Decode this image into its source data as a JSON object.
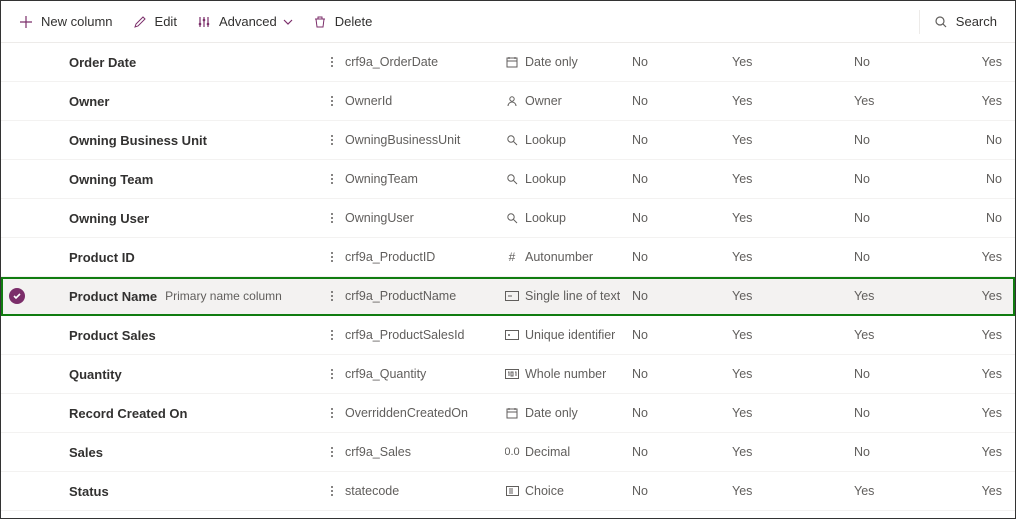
{
  "toolbar": {
    "new_column": "New column",
    "edit": "Edit",
    "advanced": "Advanced",
    "delete": "Delete",
    "search": "Search"
  },
  "type_icons": {
    "date": "calendar",
    "owner": "person",
    "lookup": "search",
    "autonumber": "hash",
    "text": "textfield",
    "unique": "id",
    "whole": "num",
    "decimal": "decimal",
    "choice": "choice"
  },
  "rows": [
    {
      "display": "Order Date",
      "badge": "",
      "name": "crf9a_OrderDate",
      "type_icon": "date",
      "type": "Date only",
      "c1": "No",
      "c2": "Yes",
      "c3": "No",
      "c4": "Yes",
      "selected": false
    },
    {
      "display": "Owner",
      "badge": "",
      "name": "OwnerId",
      "type_icon": "owner",
      "type": "Owner",
      "c1": "No",
      "c2": "Yes",
      "c3": "Yes",
      "c4": "Yes",
      "selected": false
    },
    {
      "display": "Owning Business Unit",
      "badge": "",
      "name": "OwningBusinessUnit",
      "type_icon": "lookup",
      "type": "Lookup",
      "c1": "No",
      "c2": "Yes",
      "c3": "No",
      "c4": "No",
      "selected": false
    },
    {
      "display": "Owning Team",
      "badge": "",
      "name": "OwningTeam",
      "type_icon": "lookup",
      "type": "Lookup",
      "c1": "No",
      "c2": "Yes",
      "c3": "No",
      "c4": "No",
      "selected": false
    },
    {
      "display": "Owning User",
      "badge": "",
      "name": "OwningUser",
      "type_icon": "lookup",
      "type": "Lookup",
      "c1": "No",
      "c2": "Yes",
      "c3": "No",
      "c4": "No",
      "selected": false
    },
    {
      "display": "Product ID",
      "badge": "",
      "name": "crf9a_ProductID",
      "type_icon": "autonumber",
      "type": "Autonumber",
      "c1": "No",
      "c2": "Yes",
      "c3": "No",
      "c4": "Yes",
      "selected": false
    },
    {
      "display": "Product Name",
      "badge": "Primary name column",
      "name": "crf9a_ProductName",
      "type_icon": "text",
      "type": "Single line of text",
      "c1": "No",
      "c2": "Yes",
      "c3": "Yes",
      "c4": "Yes",
      "selected": true
    },
    {
      "display": "Product Sales",
      "badge": "",
      "name": "crf9a_ProductSalesId",
      "type_icon": "unique",
      "type": "Unique identifier",
      "c1": "No",
      "c2": "Yes",
      "c3": "Yes",
      "c4": "Yes",
      "selected": false
    },
    {
      "display": "Quantity",
      "badge": "",
      "name": "crf9a_Quantity",
      "type_icon": "whole",
      "type": "Whole number",
      "c1": "No",
      "c2": "Yes",
      "c3": "No",
      "c4": "Yes",
      "selected": false
    },
    {
      "display": "Record Created On",
      "badge": "",
      "name": "OverriddenCreatedOn",
      "type_icon": "date",
      "type": "Date only",
      "c1": "No",
      "c2": "Yes",
      "c3": "No",
      "c4": "Yes",
      "selected": false
    },
    {
      "display": "Sales",
      "badge": "",
      "name": "crf9a_Sales",
      "type_icon": "decimal",
      "type": "Decimal",
      "c1": "No",
      "c2": "Yes",
      "c3": "No",
      "c4": "Yes",
      "selected": false
    },
    {
      "display": "Status",
      "badge": "",
      "name": "statecode",
      "type_icon": "choice",
      "type": "Choice",
      "c1": "No",
      "c2": "Yes",
      "c3": "Yes",
      "c4": "Yes",
      "selected": false
    }
  ]
}
